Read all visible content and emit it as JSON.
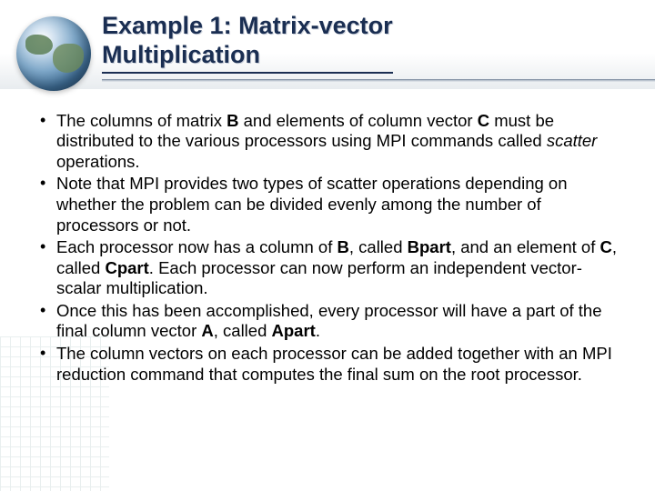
{
  "title_line1": "Example 1: Matrix-vector",
  "title_line2": "Multiplication",
  "bullets": [
    {
      "pre": "The columns of matrix ",
      "b1": "B",
      "mid1": " and elements of column vector ",
      "b2": "C",
      "mid2": " must be distributed to the various processors using MPI commands called ",
      "i1": "scatter",
      "post": " operations."
    },
    {
      "text": "Note that MPI provides two types of scatter operations depending on whether the problem can be divided evenly among the number of processors or not."
    },
    {
      "pre": "Each processor now has a column of ",
      "b1": "B",
      "mid1": ", called ",
      "b2": "Bpart",
      "mid2": ", and an element of ",
      "b3": "C",
      "mid3": ", called ",
      "b4": "Cpart",
      "post": ". Each processor can now perform an independent vector-scalar multiplication."
    },
    {
      "pre": "Once this has been accomplished, every processor will have a part of the final column vector ",
      "b1": "A",
      "mid1": ", called ",
      "b2": "Apart",
      "post": "."
    },
    {
      "text": "The column vectors on each processor can be added together with an MPI reduction command that computes the final sum on the root processor."
    }
  ]
}
